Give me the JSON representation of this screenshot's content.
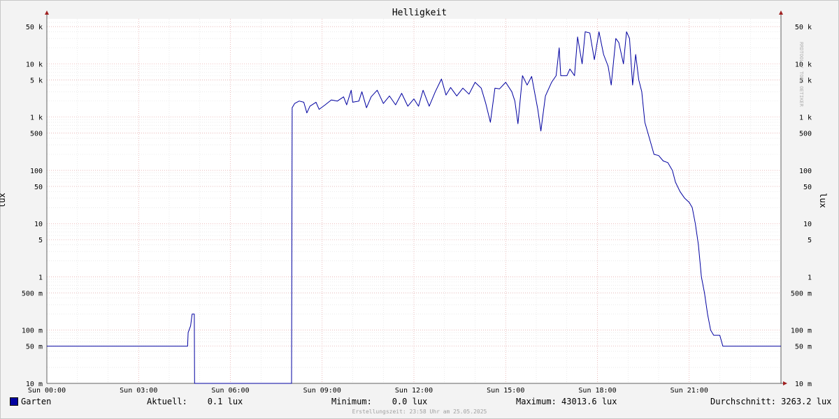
{
  "chart_data": {
    "type": "line",
    "title": "Helligkeit",
    "ylabel": "lux",
    "yscale": "log",
    "ylim": [
      0.01,
      70000
    ],
    "xlim": [
      0,
      24
    ],
    "grid": true,
    "y_ticks": [
      {
        "value": 0.01,
        "label": "10 m"
      },
      {
        "value": 0.05,
        "label": "50 m"
      },
      {
        "value": 0.1,
        "label": "100 m"
      },
      {
        "value": 0.5,
        "label": "500 m"
      },
      {
        "value": 1,
        "label": "1"
      },
      {
        "value": 5,
        "label": "5"
      },
      {
        "value": 10,
        "label": "10"
      },
      {
        "value": 50,
        "label": "50"
      },
      {
        "value": 100,
        "label": "100"
      },
      {
        "value": 500,
        "label": "500"
      },
      {
        "value": 1000,
        "label": "1 k"
      },
      {
        "value": 5000,
        "label": "5 k"
      },
      {
        "value": 10000,
        "label": "10 k"
      },
      {
        "value": 50000,
        "label": "50 k"
      }
    ],
    "x_ticks": [
      {
        "value": 0,
        "label": "Sun 00:00"
      },
      {
        "value": 3,
        "label": "Sun 03:00"
      },
      {
        "value": 6,
        "label": "Sun 06:00"
      },
      {
        "value": 9,
        "label": "Sun 09:00"
      },
      {
        "value": 12,
        "label": "Sun 12:00"
      },
      {
        "value": 15,
        "label": "Sun 15:00"
      },
      {
        "value": 18,
        "label": "Sun 18:00"
      },
      {
        "value": 21,
        "label": "Sun 21:00"
      }
    ],
    "series": [
      {
        "name": "Garten",
        "color": "#0000a0",
        "points": [
          [
            0,
            0.05
          ],
          [
            4.6,
            0.05
          ],
          [
            4.62,
            0.09
          ],
          [
            4.7,
            0.12
          ],
          [
            4.75,
            0.2
          ],
          [
            4.82,
            0.2
          ],
          [
            4.83,
            0.01
          ],
          [
            8.0,
            0.01
          ],
          [
            8.02,
            1500
          ],
          [
            8.1,
            1800
          ],
          [
            8.25,
            2000
          ],
          [
            8.4,
            1900
          ],
          [
            8.5,
            1200
          ],
          [
            8.6,
            1600
          ],
          [
            8.8,
            1900
          ],
          [
            8.9,
            1400
          ],
          [
            9.1,
            1700
          ],
          [
            9.3,
            2100
          ],
          [
            9.5,
            2000
          ],
          [
            9.7,
            2400
          ],
          [
            9.8,
            1700
          ],
          [
            9.95,
            3200
          ],
          [
            10.0,
            1900
          ],
          [
            10.2,
            2000
          ],
          [
            10.3,
            3000
          ],
          [
            10.45,
            1500
          ],
          [
            10.6,
            2400
          ],
          [
            10.8,
            3200
          ],
          [
            11.0,
            1800
          ],
          [
            11.2,
            2500
          ],
          [
            11.4,
            1700
          ],
          [
            11.6,
            2800
          ],
          [
            11.8,
            1600
          ],
          [
            12.0,
            2200
          ],
          [
            12.15,
            1600
          ],
          [
            12.3,
            3200
          ],
          [
            12.5,
            1600
          ],
          [
            12.7,
            3000
          ],
          [
            12.9,
            5200
          ],
          [
            13.05,
            2600
          ],
          [
            13.2,
            3600
          ],
          [
            13.4,
            2500
          ],
          [
            13.6,
            3500
          ],
          [
            13.8,
            2700
          ],
          [
            14.0,
            4500
          ],
          [
            14.2,
            3500
          ],
          [
            14.35,
            1800
          ],
          [
            14.5,
            800
          ],
          [
            14.65,
            3500
          ],
          [
            14.8,
            3400
          ],
          [
            15.0,
            4500
          ],
          [
            15.2,
            3000
          ],
          [
            15.3,
            2000
          ],
          [
            15.4,
            750
          ],
          [
            15.55,
            6000
          ],
          [
            15.7,
            4000
          ],
          [
            15.85,
            5800
          ],
          [
            16.05,
            1400
          ],
          [
            16.15,
            550
          ],
          [
            16.3,
            2500
          ],
          [
            16.5,
            4500
          ],
          [
            16.65,
            6000
          ],
          [
            16.75,
            20000
          ],
          [
            16.8,
            6000
          ],
          [
            17.0,
            6000
          ],
          [
            17.1,
            8000
          ],
          [
            17.25,
            6000
          ],
          [
            17.35,
            32000
          ],
          [
            17.5,
            10000
          ],
          [
            17.6,
            40000
          ],
          [
            17.75,
            38000
          ],
          [
            17.9,
            12000
          ],
          [
            18.05,
            40000
          ],
          [
            18.2,
            15000
          ],
          [
            18.35,
            9000
          ],
          [
            18.45,
            4000
          ],
          [
            18.6,
            30000
          ],
          [
            18.7,
            25000
          ],
          [
            18.85,
            10000
          ],
          [
            18.95,
            40000
          ],
          [
            19.05,
            30000
          ],
          [
            19.15,
            4000
          ],
          [
            19.25,
            15000
          ],
          [
            19.35,
            5000
          ],
          [
            19.45,
            3000
          ],
          [
            19.55,
            800
          ],
          [
            19.7,
            400
          ],
          [
            19.85,
            200
          ],
          [
            20.0,
            190
          ],
          [
            20.15,
            150
          ],
          [
            20.3,
            140
          ],
          [
            20.45,
            100
          ],
          [
            20.55,
            60
          ],
          [
            20.7,
            40
          ],
          [
            20.85,
            30
          ],
          [
            21.0,
            25
          ],
          [
            21.1,
            20
          ],
          [
            21.2,
            10
          ],
          [
            21.3,
            4
          ],
          [
            21.4,
            1
          ],
          [
            21.5,
            0.5
          ],
          [
            21.6,
            0.2
          ],
          [
            21.7,
            0.1
          ],
          [
            21.8,
            0.08
          ],
          [
            22.0,
            0.08
          ],
          [
            22.1,
            0.05
          ],
          [
            24,
            0.05
          ]
        ]
      }
    ]
  },
  "legend": {
    "name": "Garten",
    "color": "#0000a0"
  },
  "stats": {
    "current": "Aktuell:    0.1 lux",
    "minimum": "Minimum:    0.0 lux",
    "maximum": "Maximum: 43013.6 lux",
    "average": "Durchschnitt: 3263.2 lux"
  },
  "watermark": "RRDTOOL / TOBI OETIKER",
  "footer": "Erstellungszeit: 23:58 Uhr am 25.05.2025"
}
